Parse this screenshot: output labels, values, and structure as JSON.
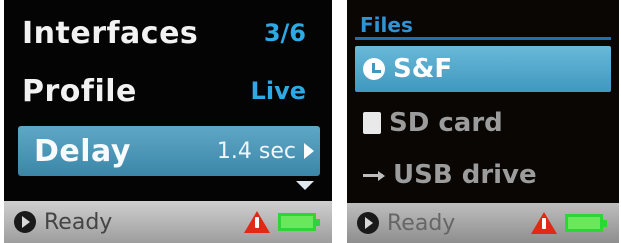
{
  "left_screen": {
    "menu": [
      {
        "label": "Interfaces",
        "value": "3/6"
      },
      {
        "label": "Profile",
        "value": "Live"
      },
      {
        "label": "Delay",
        "value": "1.4 sec",
        "selected": true
      }
    ],
    "status": {
      "text": "Ready",
      "icons": [
        "play-icon",
        "warning-icon",
        "battery-icon"
      ]
    }
  },
  "right_screen": {
    "title": "Files",
    "items": [
      {
        "label": "S&F",
        "icon": "clock-icon",
        "selected": true
      },
      {
        "label": "SD card",
        "icon": "sdcard-icon"
      },
      {
        "label": "USB drive",
        "icon": "usb-icon"
      }
    ],
    "status": {
      "text": "Ready",
      "icons": [
        "play-icon",
        "warning-icon",
        "battery-icon"
      ]
    }
  },
  "colors": {
    "accent_blue": "#2fa9e6",
    "selection": "#4d97b8",
    "warning": "#e02a16",
    "battery": "#2fd436"
  }
}
